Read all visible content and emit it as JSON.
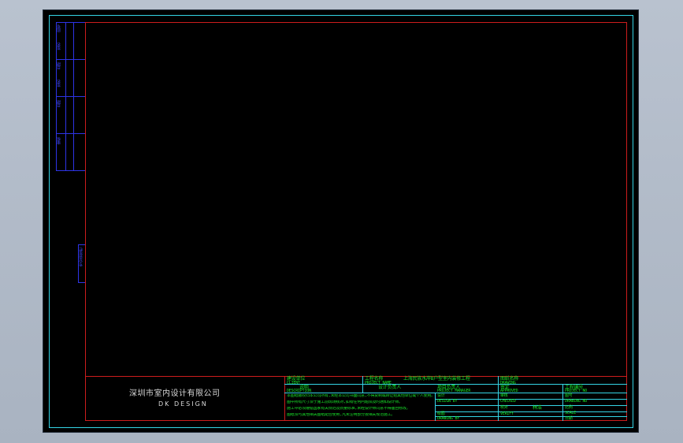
{
  "company": {
    "name_cn": "深圳市室内设计有限公司",
    "name_en": "DK  DESIGN"
  },
  "title_block": {
    "client_label_cn": "建设单位",
    "client_label_en": "CLIENT",
    "project_label_cn": "工程名称",
    "project_label_en": "PROJECT NAME",
    "project_name": "上海民族水岸B户型室内装修工程",
    "drawing_title_label_cn": "图纸名称",
    "drawing_title_label_en": "DRAWING",
    "drawing_no_label_cn": "工程编号",
    "drawing_no_label_en": "PROJECT NO",
    "description_label_cn": "说明",
    "description_label_en": "DESCRIPTION",
    "specialty": "设计负责人",
    "notes": [
      "本图纸版权归本公司所有,未经本公司书面同意,不得复制或转让给其他单位或个人使用。",
      "图中所有尺寸须于施工前现场核对,如有任何问题须及时通知设计师。",
      "施工中必须遵循国家有关规范及质量标准,未经设计师同意不得擅自修改。",
      "图纸须与其他相关图纸配合使用,凡未注明部分按相关规范施工。"
    ],
    "project_manager_cn": "项目负责人",
    "project_manager_en": "PROJECT MANAGER",
    "designer_cn": "设计",
    "designer_en": "DESIGN BY",
    "drawn_cn": "绘图",
    "drawn_en": "DRAWING BY",
    "approved_cn": "审定",
    "approved_en": "APPROVED",
    "checked_cn": "审核",
    "checked_en": "CHECKED",
    "verified_cn": "校对",
    "verified_en": "VERIFY",
    "checker_name": "林浩",
    "sheet_no_cn": "图号",
    "sheet_no_en": "DRAWING NO",
    "scale_cn": "比例",
    "scale_en": "SCALE",
    "date_cn": "日期",
    "date_en": "DATE"
  },
  "left_strip": {
    "labels": [
      "图号",
      "签名",
      "日期",
      "签名",
      "日期",
      "审核"
    ],
    "rotated_label": "专业会签栏"
  },
  "colors": {
    "frame": "#cc1d1d",
    "sheet": "#35d5e6",
    "title_text": "#19e62b",
    "strip": "#2e34e6",
    "background": "#000000"
  }
}
